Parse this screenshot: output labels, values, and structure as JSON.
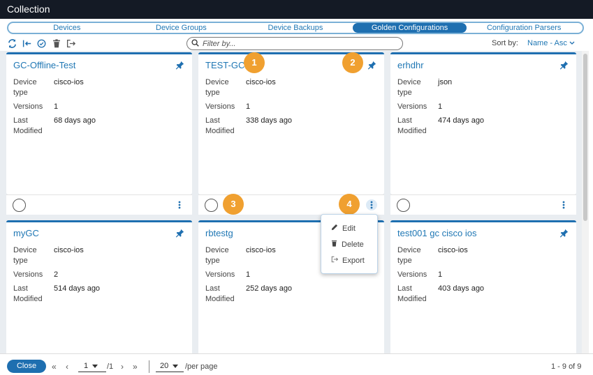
{
  "window": {
    "title": "Collection"
  },
  "tabs": [
    {
      "label": "Devices"
    },
    {
      "label": "Device Groups"
    },
    {
      "label": "Device Backups"
    },
    {
      "label": "Golden Configurations"
    },
    {
      "label": "Configuration Parsers"
    }
  ],
  "toolbar": {
    "icons": [
      "refresh-icon",
      "import-icon",
      "select-all-icon",
      "delete-icon",
      "export-icon"
    ],
    "filter_placeholder": "Filter by...",
    "sort_label": "Sort by:",
    "sort_value": "Name - Asc"
  },
  "labels": {
    "device_type_1": "Device",
    "device_type_2": "type",
    "versions": "Versions",
    "last_modified_1": "Last",
    "last_modified_2": "Modified"
  },
  "cards": [
    {
      "name": "GC-Offline-Test",
      "device_type": "cisco-ios",
      "versions": "1",
      "last_modified": "68 days ago"
    },
    {
      "name": "TEST-GC",
      "device_type": "cisco-ios",
      "versions": "1",
      "last_modified": "338 days ago"
    },
    {
      "name": "erhdhr",
      "device_type": "json",
      "versions": "1",
      "last_modified": "474 days ago"
    },
    {
      "name": "myGC",
      "device_type": "cisco-ios",
      "versions": "2",
      "last_modified": "514 days ago"
    },
    {
      "name": "rbtestg",
      "device_type": "cisco-ios",
      "versions": "1",
      "last_modified": "252 days ago"
    },
    {
      "name": "test001 gc cisco ios",
      "device_type": "cisco-ios",
      "versions": "1",
      "last_modified": "403 days ago"
    }
  ],
  "badges": [
    "1",
    "2",
    "3",
    "4"
  ],
  "context_menu": {
    "edit": "Edit",
    "delete": "Delete",
    "export": "Export"
  },
  "footer": {
    "close_label": "Close",
    "page_current": "1",
    "page_total": "/1",
    "page_size": "20",
    "per_page": "/per page",
    "range": "1 - 9 of 9"
  },
  "colors": {
    "accent": "#1e6fb0",
    "badge": "#f0a030",
    "titlebar": "#141a25"
  }
}
